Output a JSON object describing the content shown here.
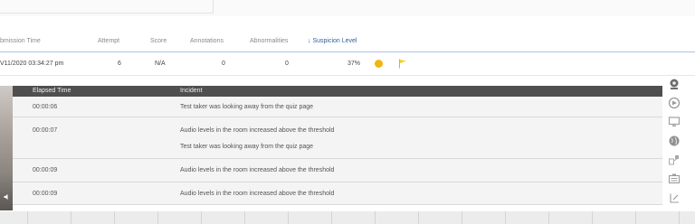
{
  "table": {
    "headers": {
      "submission_time": "bmission Time",
      "attempt": "Attempt",
      "score": "Score",
      "annotations": "Annotations",
      "abnormalities": "Abnormalities",
      "suspicion_level": "Suspicion Level",
      "sort_arrow": "↓"
    },
    "row": {
      "submission_time": "V11/2020 03:34:27 pm",
      "attempt": "6",
      "score": "N/A",
      "annotations": "0",
      "abnormalities": "0",
      "suspicion_level": "37%",
      "status_color": "#f5b50f",
      "flag_color": "#f6cf2c"
    }
  },
  "incidents": {
    "headers": {
      "elapsed": "Elapsed Time",
      "incident": "Incident"
    },
    "rows": [
      {
        "time": "00:00:06",
        "lines": [
          "Test taker was looking away from the quiz page"
        ]
      },
      {
        "time": "00:00:07",
        "lines": [
          "Audio levels in the room increased above the threshold",
          "Test taker was looking away from the quiz page"
        ]
      },
      {
        "time": "00:00:09",
        "lines": [
          "Audio levels in the room increased above the threshold"
        ]
      },
      {
        "time": "00:00:09",
        "lines": [
          "Audio levels in the room increased above the threshold"
        ]
      }
    ]
  },
  "side_icons": [
    "webcam-icon",
    "record-icon",
    "monitor-icon",
    "globe-icon",
    "network-icon",
    "id-card-icon",
    "gavel-icon"
  ],
  "colors": {
    "accent": "#2e5f9e",
    "incident_header": "#4f4f4f",
    "incident_body": "#f4f4f4",
    "status_dot": "#f5b50f"
  }
}
